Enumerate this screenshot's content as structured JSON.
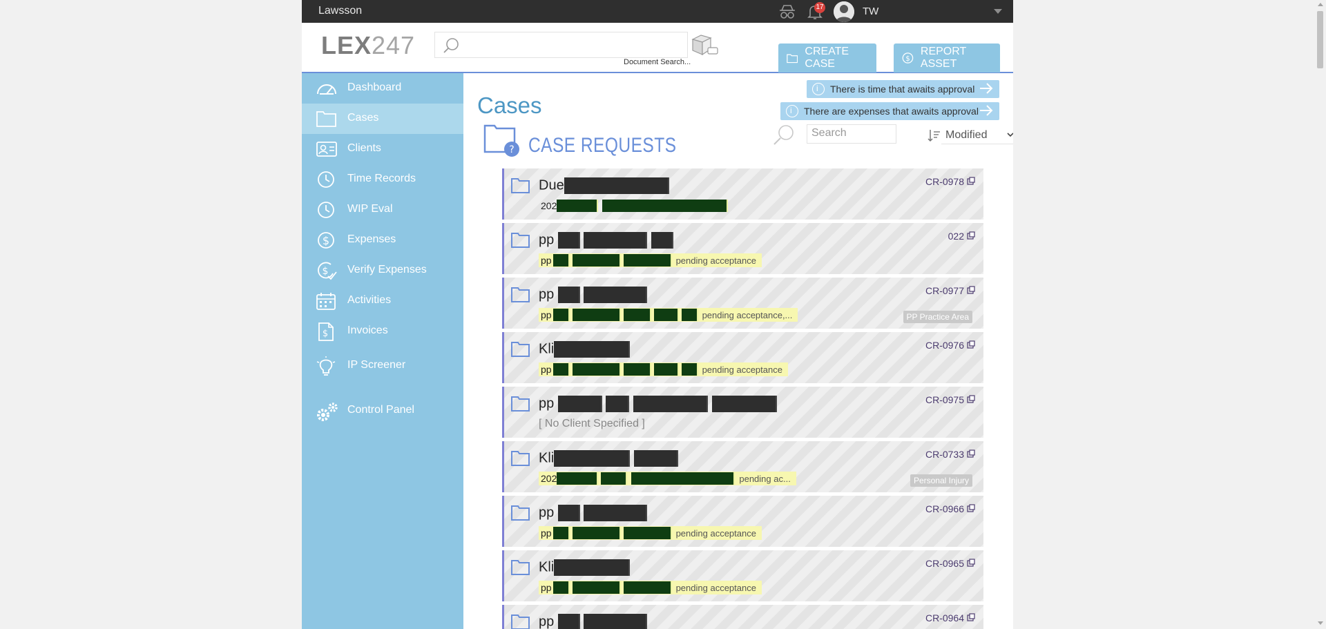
{
  "topbar": {
    "org_name": "Lawsson",
    "notification_count": "17",
    "user_initials": "TW"
  },
  "header": {
    "logo_main": "LEX",
    "logo_num": "247",
    "search_placeholder": "",
    "search_label": "Document Search...",
    "create_case_label": "CREATE CASE",
    "report_asset_label": "REPORT ASSET"
  },
  "sidebar": {
    "items": [
      {
        "label": "Dashboard",
        "icon": "dashboard-icon"
      },
      {
        "label": "Cases",
        "icon": "folder-icon",
        "active": true
      },
      {
        "label": "Clients",
        "icon": "clients-icon"
      },
      {
        "label": "Time Records",
        "icon": "clock-icon"
      },
      {
        "label": "WIP Eval",
        "icon": "clock-icon"
      },
      {
        "label": "Expenses",
        "icon": "dollar-icon"
      },
      {
        "label": "Verify Expenses",
        "icon": "verify-dollar-icon"
      },
      {
        "label": "Activities",
        "icon": "calendar-icon"
      },
      {
        "label": "Invoices",
        "icon": "invoice-icon"
      },
      {
        "label": "IP Screener",
        "icon": "lightbulb-icon"
      },
      {
        "label": "Control Panel",
        "icon": "gears-icon"
      }
    ]
  },
  "main": {
    "title": "Cases",
    "notices": [
      "There is time that awaits approval",
      "There are expenses that awaits approval"
    ],
    "section_title": "CASE REQUESTS",
    "search_placeholder": "Search",
    "sort_value": "Modified"
  },
  "cases": [
    {
      "title_prefix": "Due",
      "id": "CR-0978",
      "sub_prefix": "202",
      "pending": "",
      "tag": ""
    },
    {
      "title_prefix": "pp",
      "id": "022",
      "sub_prefix": "pp",
      "pending": "pending acceptance",
      "tag": ""
    },
    {
      "title_prefix": "pp",
      "id": "CR-0977",
      "sub_prefix": "pp",
      "pending": "pending acceptance,...",
      "tag": "PP Practice Area"
    },
    {
      "title_prefix": "Kli",
      "id": "CR-0976",
      "sub_prefix": "pp",
      "pending": "pending acceptance",
      "tag": ""
    },
    {
      "title_prefix": "pp",
      "id": "CR-0975",
      "sub_prefix": "[ No Client Specified ]",
      "pending": "",
      "tag": ""
    },
    {
      "title_prefix": "Kli",
      "id": "CR-0733",
      "sub_prefix": "202",
      "pending": "pending ac...",
      "tag": "Personal Injury"
    },
    {
      "title_prefix": "pp",
      "id": "CR-0966",
      "sub_prefix": "pp",
      "pending": "pending acceptance",
      "tag": ""
    },
    {
      "title_prefix": "Kli",
      "id": "CR-0965",
      "sub_prefix": "pp",
      "pending": "pending acceptance",
      "tag": ""
    },
    {
      "title_prefix": "pp",
      "id": "CR-0964",
      "sub_prefix": "",
      "pending": "",
      "tag": ""
    }
  ]
}
